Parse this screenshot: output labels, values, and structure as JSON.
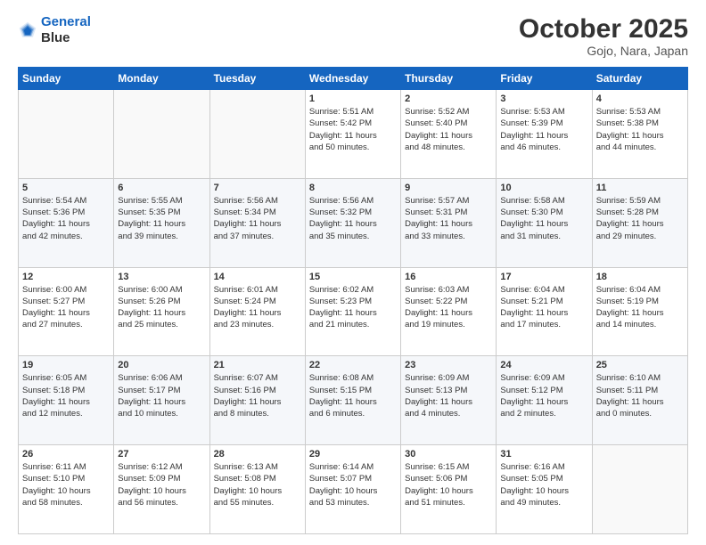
{
  "header": {
    "logo_line1": "General",
    "logo_line2": "Blue",
    "title": "October 2025",
    "subtitle": "Gojo, Nara, Japan"
  },
  "weekdays": [
    "Sunday",
    "Monday",
    "Tuesday",
    "Wednesday",
    "Thursday",
    "Friday",
    "Saturday"
  ],
  "weeks": [
    [
      {
        "day": "",
        "info": ""
      },
      {
        "day": "",
        "info": ""
      },
      {
        "day": "",
        "info": ""
      },
      {
        "day": "1",
        "info": "Sunrise: 5:51 AM\nSunset: 5:42 PM\nDaylight: 11 hours\nand 50 minutes."
      },
      {
        "day": "2",
        "info": "Sunrise: 5:52 AM\nSunset: 5:40 PM\nDaylight: 11 hours\nand 48 minutes."
      },
      {
        "day": "3",
        "info": "Sunrise: 5:53 AM\nSunset: 5:39 PM\nDaylight: 11 hours\nand 46 minutes."
      },
      {
        "day": "4",
        "info": "Sunrise: 5:53 AM\nSunset: 5:38 PM\nDaylight: 11 hours\nand 44 minutes."
      }
    ],
    [
      {
        "day": "5",
        "info": "Sunrise: 5:54 AM\nSunset: 5:36 PM\nDaylight: 11 hours\nand 42 minutes."
      },
      {
        "day": "6",
        "info": "Sunrise: 5:55 AM\nSunset: 5:35 PM\nDaylight: 11 hours\nand 39 minutes."
      },
      {
        "day": "7",
        "info": "Sunrise: 5:56 AM\nSunset: 5:34 PM\nDaylight: 11 hours\nand 37 minutes."
      },
      {
        "day": "8",
        "info": "Sunrise: 5:56 AM\nSunset: 5:32 PM\nDaylight: 11 hours\nand 35 minutes."
      },
      {
        "day": "9",
        "info": "Sunrise: 5:57 AM\nSunset: 5:31 PM\nDaylight: 11 hours\nand 33 minutes."
      },
      {
        "day": "10",
        "info": "Sunrise: 5:58 AM\nSunset: 5:30 PM\nDaylight: 11 hours\nand 31 minutes."
      },
      {
        "day": "11",
        "info": "Sunrise: 5:59 AM\nSunset: 5:28 PM\nDaylight: 11 hours\nand 29 minutes."
      }
    ],
    [
      {
        "day": "12",
        "info": "Sunrise: 6:00 AM\nSunset: 5:27 PM\nDaylight: 11 hours\nand 27 minutes."
      },
      {
        "day": "13",
        "info": "Sunrise: 6:00 AM\nSunset: 5:26 PM\nDaylight: 11 hours\nand 25 minutes."
      },
      {
        "day": "14",
        "info": "Sunrise: 6:01 AM\nSunset: 5:24 PM\nDaylight: 11 hours\nand 23 minutes."
      },
      {
        "day": "15",
        "info": "Sunrise: 6:02 AM\nSunset: 5:23 PM\nDaylight: 11 hours\nand 21 minutes."
      },
      {
        "day": "16",
        "info": "Sunrise: 6:03 AM\nSunset: 5:22 PM\nDaylight: 11 hours\nand 19 minutes."
      },
      {
        "day": "17",
        "info": "Sunrise: 6:04 AM\nSunset: 5:21 PM\nDaylight: 11 hours\nand 17 minutes."
      },
      {
        "day": "18",
        "info": "Sunrise: 6:04 AM\nSunset: 5:19 PM\nDaylight: 11 hours\nand 14 minutes."
      }
    ],
    [
      {
        "day": "19",
        "info": "Sunrise: 6:05 AM\nSunset: 5:18 PM\nDaylight: 11 hours\nand 12 minutes."
      },
      {
        "day": "20",
        "info": "Sunrise: 6:06 AM\nSunset: 5:17 PM\nDaylight: 11 hours\nand 10 minutes."
      },
      {
        "day": "21",
        "info": "Sunrise: 6:07 AM\nSunset: 5:16 PM\nDaylight: 11 hours\nand 8 minutes."
      },
      {
        "day": "22",
        "info": "Sunrise: 6:08 AM\nSunset: 5:15 PM\nDaylight: 11 hours\nand 6 minutes."
      },
      {
        "day": "23",
        "info": "Sunrise: 6:09 AM\nSunset: 5:13 PM\nDaylight: 11 hours\nand 4 minutes."
      },
      {
        "day": "24",
        "info": "Sunrise: 6:09 AM\nSunset: 5:12 PM\nDaylight: 11 hours\nand 2 minutes."
      },
      {
        "day": "25",
        "info": "Sunrise: 6:10 AM\nSunset: 5:11 PM\nDaylight: 11 hours\nand 0 minutes."
      }
    ],
    [
      {
        "day": "26",
        "info": "Sunrise: 6:11 AM\nSunset: 5:10 PM\nDaylight: 10 hours\nand 58 minutes."
      },
      {
        "day": "27",
        "info": "Sunrise: 6:12 AM\nSunset: 5:09 PM\nDaylight: 10 hours\nand 56 minutes."
      },
      {
        "day": "28",
        "info": "Sunrise: 6:13 AM\nSunset: 5:08 PM\nDaylight: 10 hours\nand 55 minutes."
      },
      {
        "day": "29",
        "info": "Sunrise: 6:14 AM\nSunset: 5:07 PM\nDaylight: 10 hours\nand 53 minutes."
      },
      {
        "day": "30",
        "info": "Sunrise: 6:15 AM\nSunset: 5:06 PM\nDaylight: 10 hours\nand 51 minutes."
      },
      {
        "day": "31",
        "info": "Sunrise: 6:16 AM\nSunset: 5:05 PM\nDaylight: 10 hours\nand 49 minutes."
      },
      {
        "day": "",
        "info": ""
      }
    ]
  ]
}
